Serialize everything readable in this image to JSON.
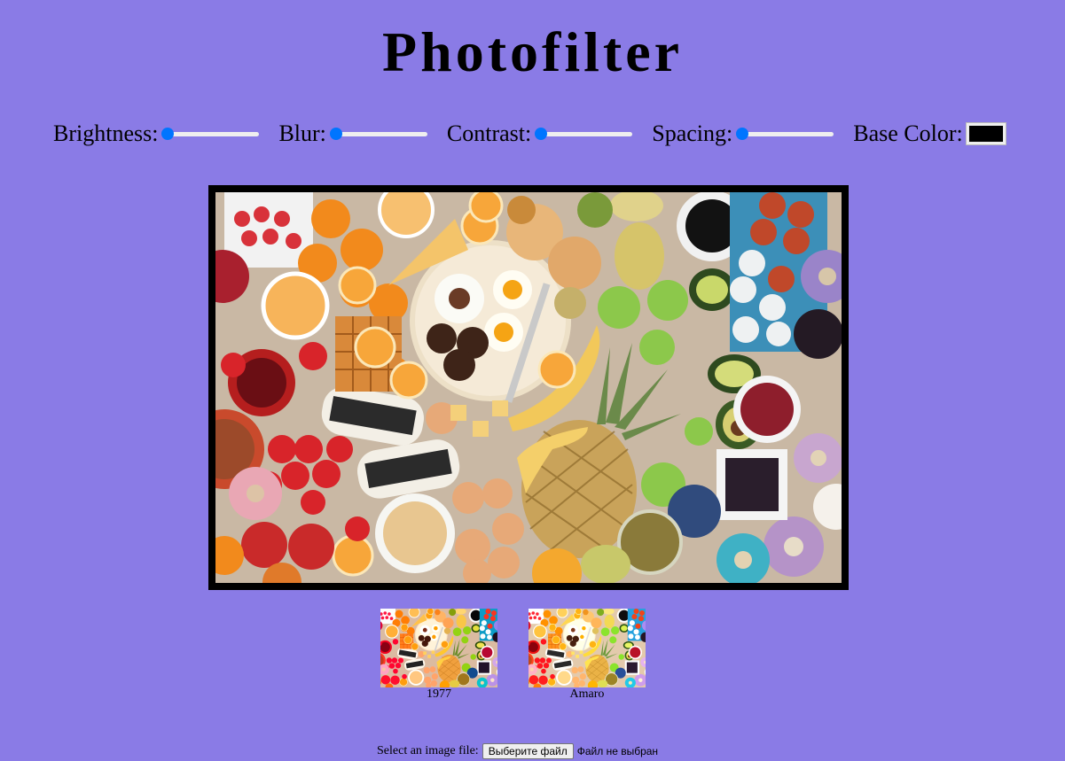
{
  "app": {
    "title": "Photofilter"
  },
  "controls": {
    "brightness": {
      "label": "Brightness:",
      "value": 0
    },
    "blur": {
      "label": "Blur:",
      "value": 0
    },
    "contrast": {
      "label": "Contrast:",
      "value": 0
    },
    "spacing": {
      "label": "Spacing:",
      "value": 0
    },
    "base_color": {
      "label": "Base Color:",
      "value": "#000000"
    }
  },
  "colors": {
    "background": "#8a7be6",
    "slider_accent": "#0075ff",
    "frame": "#000000"
  },
  "main_image": {
    "alt": "Overhead spread of breakfast foods, fruits, pineapple, donuts and eggs"
  },
  "filters": [
    {
      "name": "1977"
    },
    {
      "name": "Amaro"
    }
  ],
  "file_picker": {
    "label": "Select an image file:",
    "button": "Выберите файл",
    "status": "Файл не выбран"
  }
}
